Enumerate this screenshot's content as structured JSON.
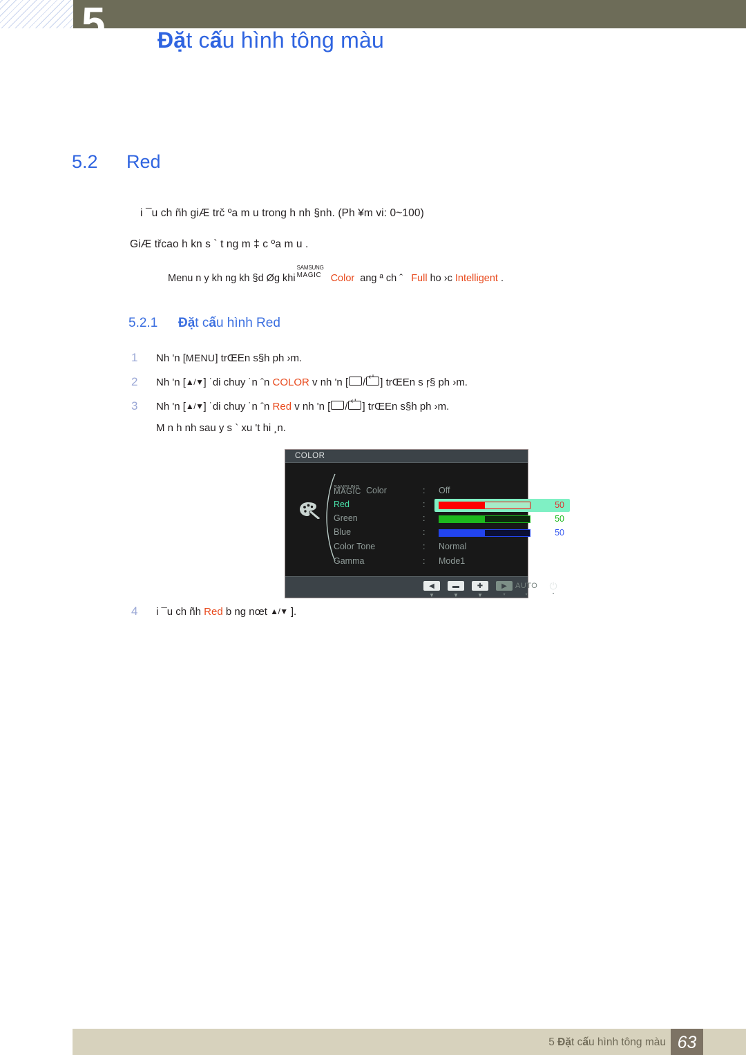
{
  "header": {
    "chapter_number": "5",
    "title_bold": "Đặ",
    "title_rest": "t c",
    "title_bold2": "ấ",
    "title_rest2": "u hình tông màu",
    "title_full": "Đặt cấu hình tông màu",
    "bar_color": "#6d6c58",
    "title_color": "#2f64e0"
  },
  "section": {
    "number": "5.2",
    "title": "Red",
    "paragraph_1": "i ¯u ch ñh giÆ trč ºa m u       trong h nh  §nh. (Ph ¥m vi: 0~100)",
    "paragraph_2": "GiÆ třcao h kn s ` t  ng m ‡     c ºa m u      ."
  },
  "note": {
    "prefix": "Menu n y kh ng kh   §d Øg khi",
    "magic_top": "SAMSUNG",
    "magic_bottom": "MAGIC",
    "magic_word": "Color",
    "middle": "ang  ª ch ˆ",
    "option_1": "Full",
    "joiner": "ho ›c",
    "option_2": "Intelligent",
    "suffix": ".",
    "accent_color": "#e8491c"
  },
  "subsection": {
    "number": "5.2.1",
    "title_bold": "Đặ",
    "title_mid": "t c",
    "title_bold2": "ấ",
    "title_rest": "u hình Red",
    "title_full": "Đặt cấu hình Red"
  },
  "steps": [
    {
      "index": "1",
      "part_a": "Nh 'n [",
      "key": "MENU",
      "part_b": "] trŒEn s§h ph ›m."
    },
    {
      "index": "2",
      "part_a": "Nh 'n [",
      "arrows": "▲/▼",
      "part_b": "]    ˙di chuy ˙n     ˆn",
      "highlight": "COLOR",
      "part_c": "v  nh 'n [",
      "part_d": "] trŒEn s ŗ§ ph ›m."
    },
    {
      "index": "3",
      "part_a": "Nh 'n [",
      "arrows": "▲/▼",
      "part_b": "]    ˙di chuy ˙n     ˆn",
      "highlight": "Red",
      "part_c": "v  nh 'n [",
      "part_d": "] trŒEn s§h ph ›m."
    }
  ],
  "step_3_note": "M n h nh sau     y s ` xu 't hi ¸n.",
  "step_4": {
    "index": "4",
    "part_a": "i ¯u ch ñh",
    "highlight": "Red",
    "part_b": "b  ng nœt",
    "arrows": "▲/▼",
    "part_c": "]."
  },
  "osd": {
    "title": "COLOR",
    "rows": [
      {
        "label_top": "SAMSUNG",
        "label_mid": "MAGIC",
        "label_word": "Color",
        "type": "text",
        "value": "Off",
        "selected": false
      },
      {
        "label": "Red",
        "type": "slider",
        "value": "50",
        "fill_percent": 50,
        "fill_color": "#ff0000",
        "track_border": "#ff0000",
        "track_bg": "#a6ecc8",
        "num_color": "#e03030",
        "selected": true
      },
      {
        "label": "Green",
        "type": "slider",
        "value": "50",
        "fill_percent": 50,
        "fill_color": "#1db91d",
        "track_border": "#1db91d",
        "track_bg": "#0d2a0d",
        "num_color": "#1db91d",
        "selected": false
      },
      {
        "label": "Blue",
        "type": "slider",
        "value": "50",
        "fill_percent": 50,
        "fill_color": "#2244ee",
        "track_border": "#2244ee",
        "track_bg": "#0b0f34",
        "num_color": "#3b5cf0",
        "selected": false
      },
      {
        "label": "Color Tone",
        "type": "text",
        "value": "Normal",
        "selected": false
      },
      {
        "label": "Gamma",
        "type": "text",
        "value": "Mode1",
        "selected": false
      }
    ],
    "footer_buttons": [
      {
        "glyph": "◀",
        "caret": "▼",
        "style": "light"
      },
      {
        "glyph": "▬",
        "caret": "▼",
        "style": "light"
      },
      {
        "glyph": "✚",
        "caret": "▼",
        "style": "light"
      },
      {
        "glyph": "▶",
        "caret": "▾",
        "style": "dim"
      }
    ],
    "auto_label": "AUTO",
    "auto_caret": "▾",
    "power_glyph": "⏻",
    "power_caret": "▪"
  },
  "footer": {
    "chapter": "5 ",
    "title_bold": "Đặ",
    "title_mid": "t c",
    "title_bold2": "ấ",
    "title_rest": "u hình tông màu",
    "title_full": "5 Đặt cấu hình tông màu",
    "page_number": "63",
    "bar_color": "#d7d2bd",
    "page_box_color": "#7d7364"
  }
}
